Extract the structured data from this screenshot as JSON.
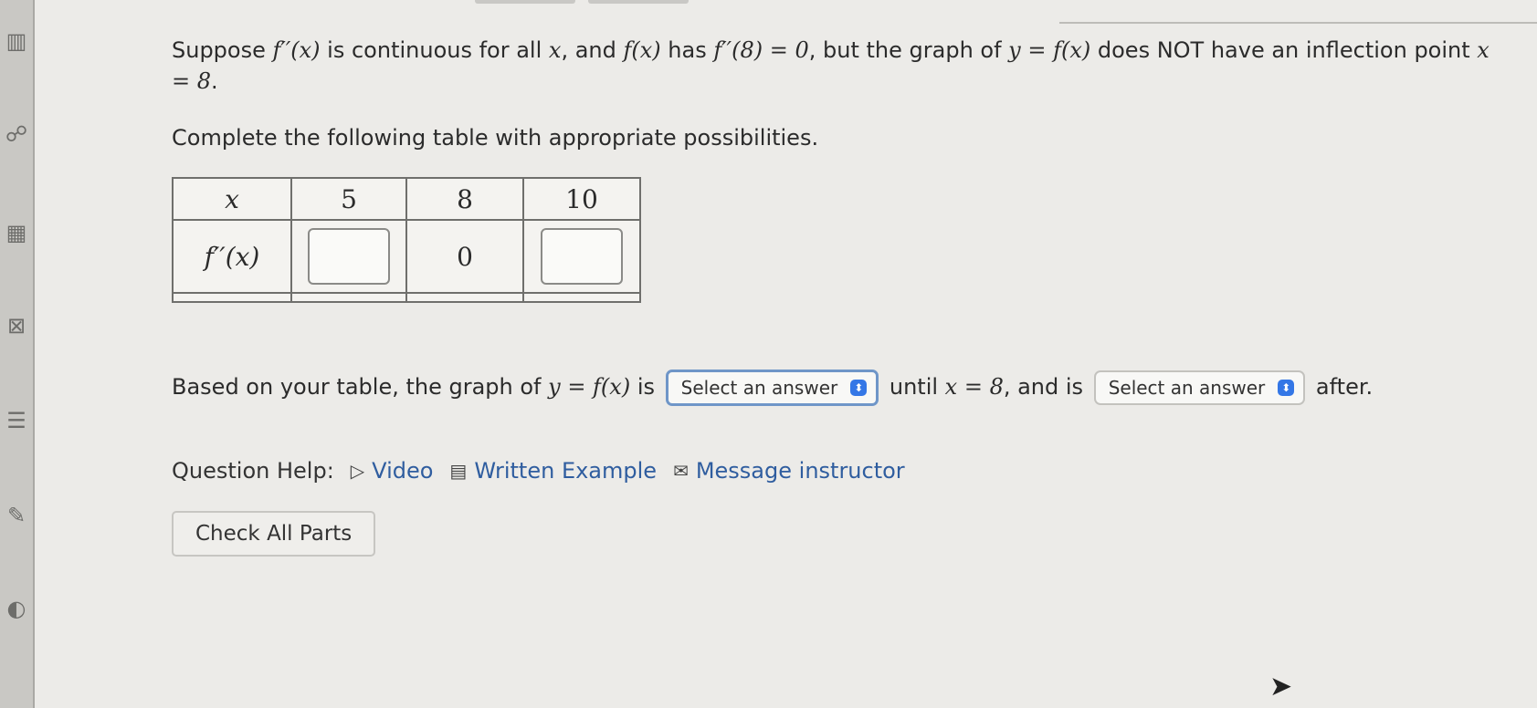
{
  "question": {
    "intro": {
      "t1": "Suppose ",
      "m1": "f′′(x)",
      "t2": " is continuous for all ",
      "m2": "x",
      "t3": ", and ",
      "m3": "f(x)",
      "t4": " has ",
      "m4": "f′′(8) = 0",
      "t5": ", but the graph of ",
      "m5": "y = f(x)",
      "t6": " does NOT have an inflection point ",
      "m6": "x = 8",
      "t7": "."
    },
    "instruction": "Complete the following table with appropriate possibilities."
  },
  "table": {
    "header": [
      "x",
      "5",
      "8",
      "10"
    ],
    "row_label": "f′′(x)",
    "value_at_8": "0"
  },
  "sentence": {
    "t1": "Based on your table, the graph of ",
    "m1": "y = f(x)",
    "t2": " is ",
    "select1": "Select an answer",
    "t3": " until ",
    "m2": "x = 8",
    "t4": ", and is ",
    "select2": "Select an answer",
    "t5": " after."
  },
  "help": {
    "label": "Question Help:",
    "video": "Video",
    "example": "Written Example",
    "message": "Message instructor"
  },
  "check_button": "Check All Parts",
  "icons": {
    "video": "play-icon",
    "example": "document-icon",
    "message": "envelope-icon",
    "select": "chevron-updown-icon"
  },
  "colors": {
    "link": "#2f5d9f",
    "select_accent": "#3477e6"
  }
}
